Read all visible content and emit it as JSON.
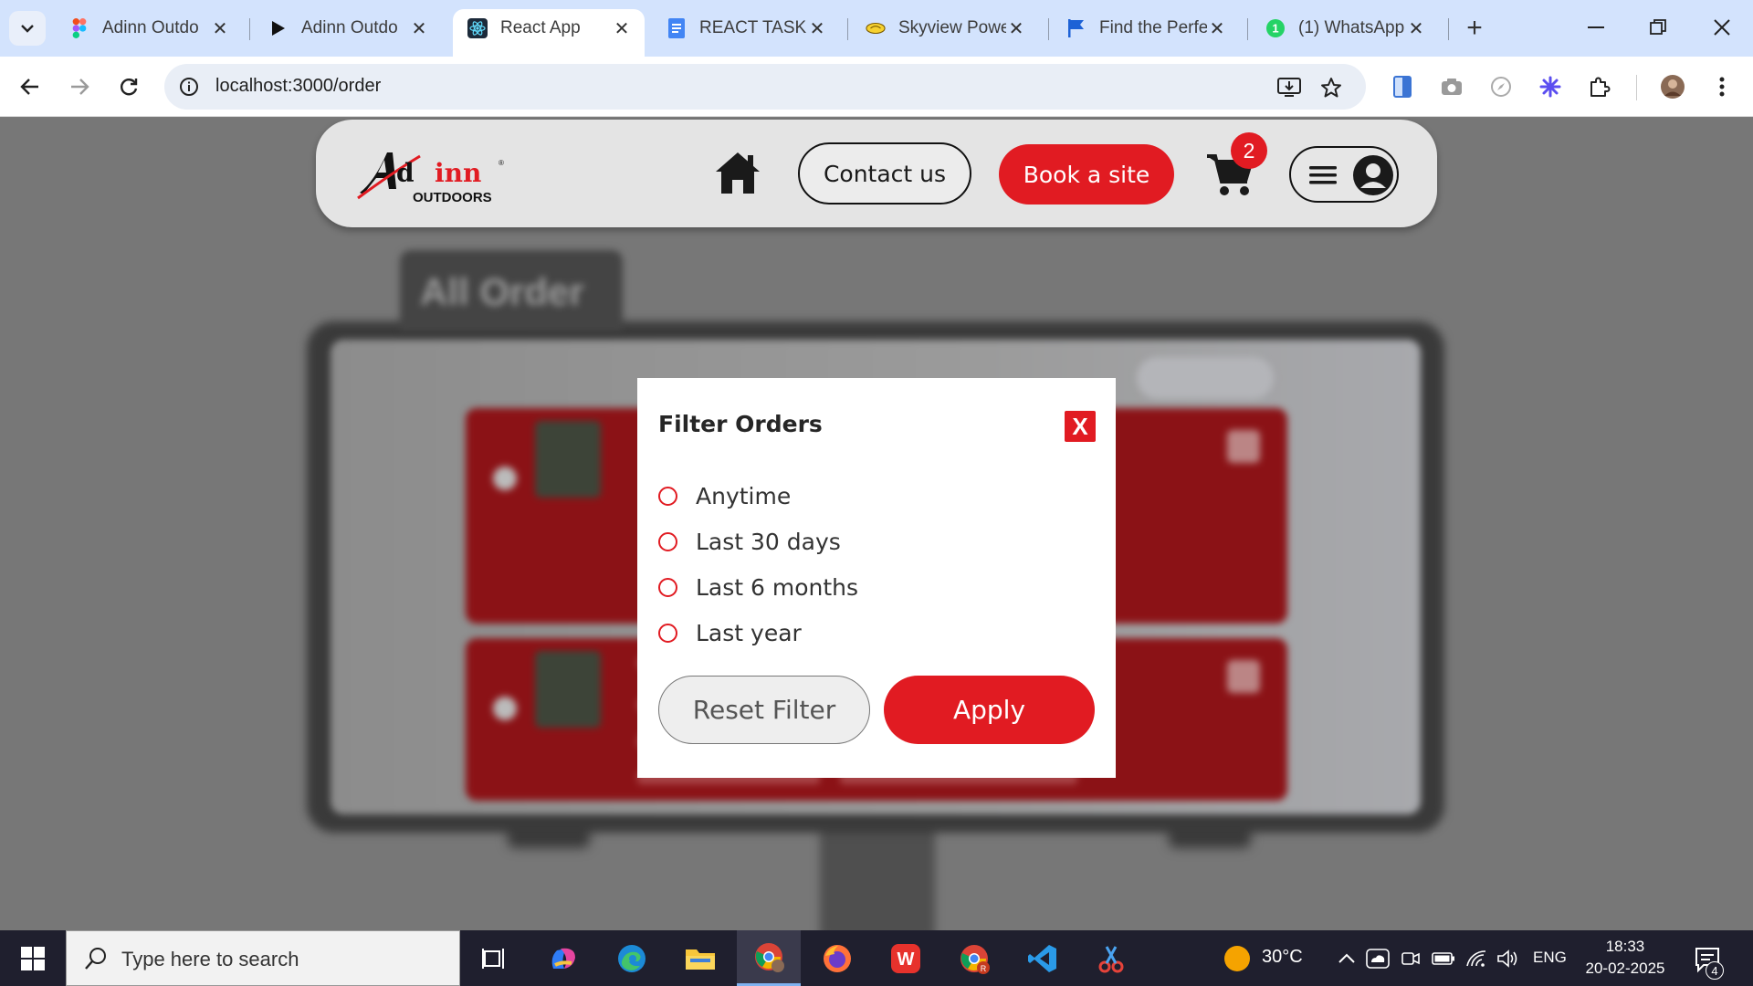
{
  "browser": {
    "tabs": [
      {
        "title": "Adinn Outdo",
        "icon": "figma-icon"
      },
      {
        "title": "Adinn Outdo",
        "icon": "play-icon"
      },
      {
        "title": "React App",
        "icon": "react-icon",
        "active": true
      },
      {
        "title": "REACT TASKS",
        "icon": "docs-icon"
      },
      {
        "title": "Skyview Powe",
        "icon": "skyview-icon"
      },
      {
        "title": "Find the Perfe",
        "icon": "flag-icon"
      },
      {
        "title": "(1) WhatsApp",
        "icon": "whatsapp-icon"
      }
    ],
    "url": "localhost:3000/order"
  },
  "navbar": {
    "logo_text": "Ad inn",
    "logo_sub": "OUTDOORS",
    "contact_label": "Contact us",
    "book_label": "Book a site",
    "cart_count": "2"
  },
  "background": {
    "heading": "All Order"
  },
  "modal": {
    "title": "Filter Orders",
    "close_label": "X",
    "options": [
      "Anytime",
      "Last 30 days",
      "Last 6 months",
      "Last year"
    ],
    "reset_label": "Reset Filter",
    "apply_label": "Apply"
  },
  "taskbar": {
    "search_placeholder": "Type here to search",
    "weather": "30°C",
    "language": "ENG",
    "time": "18:33",
    "date": "20-02-2025",
    "notification_count": "4"
  },
  "colors": {
    "accent": "#e11b22",
    "tabstrip": "#d3e3fd",
    "taskbar": "#1f1f2e"
  }
}
